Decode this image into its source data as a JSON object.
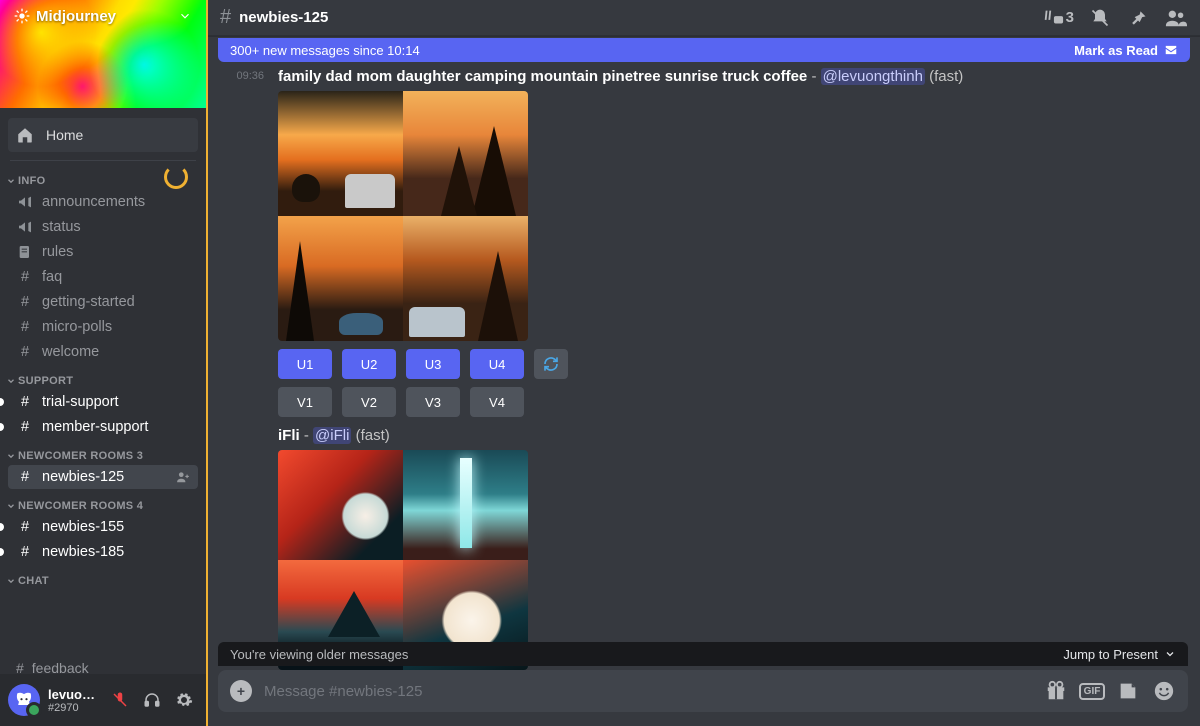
{
  "server": {
    "name": "Midjourney"
  },
  "home_label": "Home",
  "categories": [
    {
      "name": "INFO",
      "channels": [
        {
          "label": "announcements",
          "icon": "megaphone"
        },
        {
          "label": "status",
          "icon": "megaphone"
        },
        {
          "label": "rules",
          "icon": "rules"
        },
        {
          "label": "faq",
          "icon": "hash"
        },
        {
          "label": "getting-started",
          "icon": "hash"
        },
        {
          "label": "micro-polls",
          "icon": "hash"
        },
        {
          "label": "welcome",
          "icon": "hash"
        }
      ]
    },
    {
      "name": "SUPPORT",
      "channels": [
        {
          "label": "trial-support",
          "icon": "hash",
          "unread": true
        },
        {
          "label": "member-support",
          "icon": "hash",
          "unread": true
        }
      ]
    },
    {
      "name": "NEWCOMER ROOMS 3",
      "channels": [
        {
          "label": "newbies-125",
          "icon": "hash",
          "active": true
        }
      ]
    },
    {
      "name": "NEWCOMER ROOMS 4",
      "channels": [
        {
          "label": "newbies-155",
          "icon": "hash",
          "unread": true
        },
        {
          "label": "newbies-185",
          "icon": "hash",
          "unread": true
        }
      ]
    },
    {
      "name": "CHAT",
      "channels": []
    }
  ],
  "partial_channel": "feedback",
  "user": {
    "name": "levuongthi...",
    "tag": "#2970"
  },
  "header": {
    "channel": "newbies-125",
    "threads_count": "3"
  },
  "new_messages_bar": {
    "text": "300+ new messages since 10:14",
    "mark": "Mark as Read"
  },
  "message1": {
    "timestamp": "09:36",
    "prompt": "family dad mom daughter camping mountain pinetree sunrise truck coffee",
    "mention": "@levuongthinh",
    "mode": "(fast)",
    "u_buttons": [
      "U1",
      "U2",
      "U3",
      "U4"
    ],
    "v_buttons": [
      "V1",
      "V2",
      "V3",
      "V4"
    ]
  },
  "message2": {
    "prompt": "iFli",
    "mention": "@iFli",
    "mode": "(fast)"
  },
  "older_bar": {
    "text": "You're viewing older messages",
    "jump": "Jump to Present"
  },
  "composer": {
    "placeholder": "Message #newbies-125"
  }
}
